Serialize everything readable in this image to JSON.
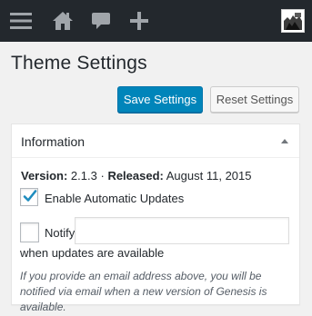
{
  "admin_bar": {
    "items": [
      "menu-toggle",
      "home",
      "comments",
      "new-content"
    ],
    "background": "#23282d",
    "icon_color": "#a0a5aa"
  },
  "page": {
    "title": "Theme Settings"
  },
  "actions": {
    "save_label": "Save Settings",
    "reset_label": "Reset Settings",
    "primary_color": "#0085ba"
  },
  "info_box": {
    "title": "Information",
    "version_label": "Version:",
    "version_value": "2.1.3",
    "separator": "·",
    "released_label": "Released:",
    "released_value": "August 11, 2015",
    "auto_updates": {
      "label": "Enable Automatic Updates",
      "checked": true
    },
    "notify": {
      "label": "Notify",
      "checked": false,
      "email_value": "",
      "after_label": "when updates are available"
    },
    "description": "If you provide an email address above, you will be notified via email when a new version of Genesis is available."
  }
}
